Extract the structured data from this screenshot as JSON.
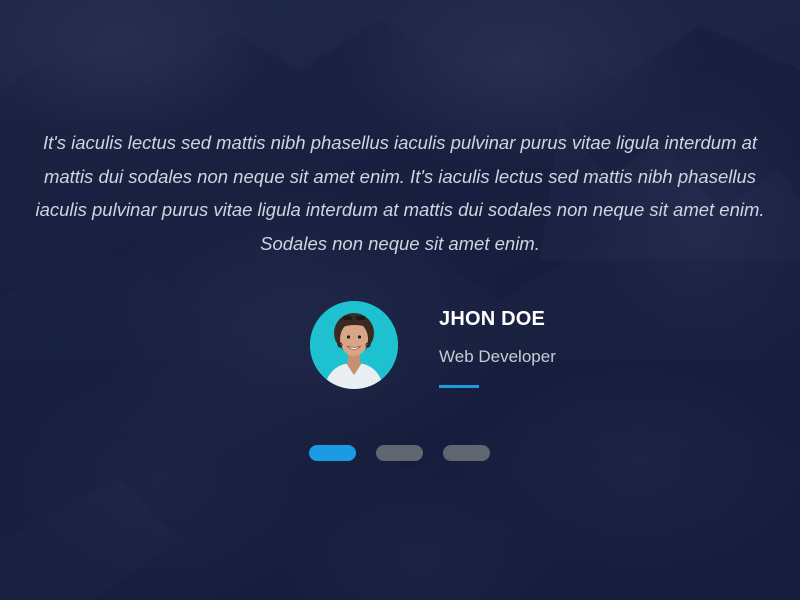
{
  "testimonial": {
    "quote": "It's iaculis lectus sed mattis nibh phasellus iaculis pulvinar purus vitae ligula interdum at mattis dui sodales non neque sit amet enim. It's iaculis lectus sed mattis nibh phasellus iaculis pulvinar purus vitae ligula interdum at mattis dui sodales non neque sit amet enim. Sodales non neque sit amet enim.",
    "author": {
      "name": "JHON DOE",
      "role": "Web Developer",
      "avatar_bg": "#1ec1cf"
    }
  },
  "pager": {
    "count": 3,
    "active_index": 0,
    "active_color": "#1b9be3",
    "inactive_color": "#5f6670"
  },
  "colors": {
    "background": "#1b2240",
    "accent": "#1e9bdc"
  }
}
